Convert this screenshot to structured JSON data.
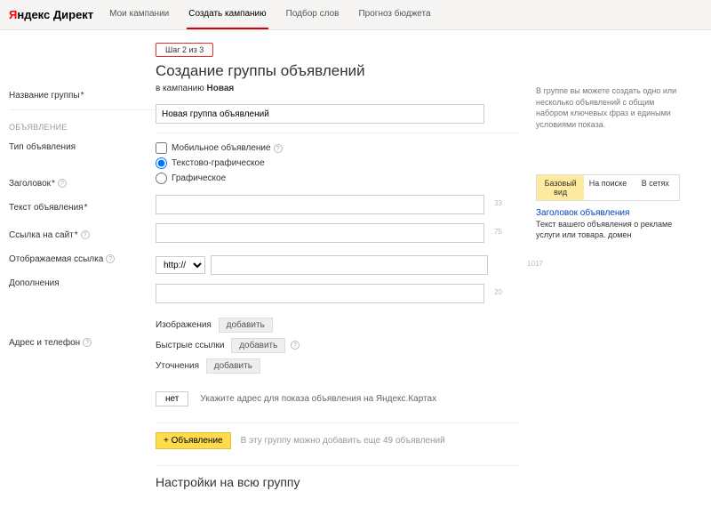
{
  "header": {
    "logo_ya": "Я",
    "logo_ndex": "ндекс",
    "logo_direct": "Директ",
    "nav": {
      "my_campaigns": "Мои кампании",
      "create_campaign": "Создать кампанию",
      "word_selection": "Подбор слов",
      "budget_forecast": "Прогноз бюджета"
    }
  },
  "step": "Шаг 2 из 3",
  "page_title": "Создание группы объявлений",
  "subtitle_prefix": "в кампанию ",
  "subtitle_bold": "Новая",
  "labels": {
    "group_name": "Название группы",
    "ad_section": "ОБЪЯВЛЕНИЕ",
    "ad_type": "Тип объявления",
    "headline": "Заголовок",
    "ad_text": "Текст объявления",
    "site_link": "Ссылка на сайт",
    "display_link": "Отображаемая ссылка",
    "additions": "Дополнения",
    "address_phone": "Адрес и телефон"
  },
  "inputs": {
    "group_name_value": "Новая группа объявлений",
    "headline_value": "",
    "ad_text_value": "",
    "site_link_value": "",
    "display_link_value": "",
    "protocol": "http://"
  },
  "counters": {
    "headline": "33",
    "ad_text": "75",
    "site_link": "1017",
    "display_link": "20"
  },
  "ad_type": {
    "mobile": "Мобильное объявление",
    "text_graphic": "Текстово-графическое",
    "graphic": "Графическое"
  },
  "additions": {
    "images": "Изображения",
    "quick_links": "Быстрые ссылки",
    "clarifications": "Уточнения",
    "add_btn": "добавить"
  },
  "address": {
    "toggle": "нет",
    "hint": "Укажите адрес для показа объявления на Яндекс.Картах"
  },
  "add_ad": {
    "button": "+ Объявление",
    "hint": "В эту группу можно добавить еще 49 объявлений"
  },
  "group_settings_title": "Настройки на всю группу",
  "right": {
    "help_text": "В группе вы можете создать одно или несколько объявлений с общим набором ключевых фраз и едиными условиями показа.",
    "tabs": {
      "basic": "Базовый вид",
      "search": "На поиске",
      "networks": "В сетях"
    },
    "preview_title": "Заголовок объявления",
    "preview_text": "Текст вашего объявления о рекламе услуги или товара. домен"
  }
}
